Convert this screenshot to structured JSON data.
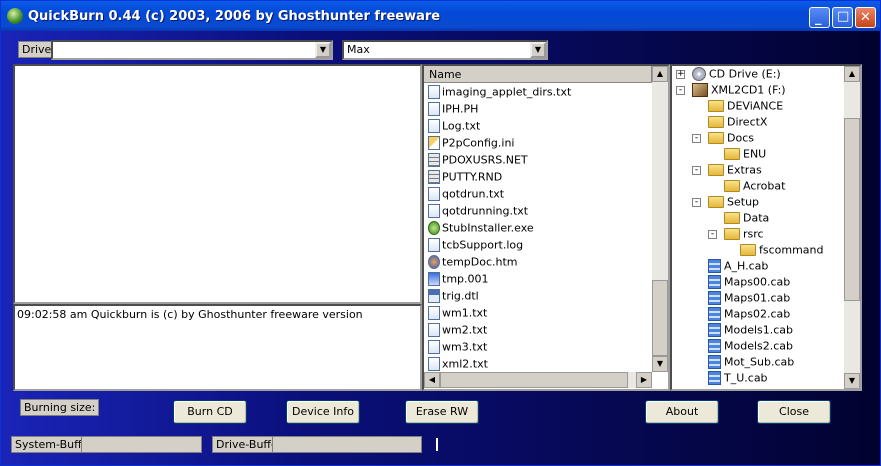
{
  "window": {
    "title": "QuickBurn 0.44 (c) 2003, 2006 by Ghosthunter freeware",
    "controls": {
      "minimize": "_",
      "maximize": "□",
      "close": "✕"
    }
  },
  "toolbar": {
    "drive_label": "Drive",
    "drive_value": "",
    "speed_value": "Max"
  },
  "log": {
    "message": "09:02:58 am Quickburn is (c) by Ghosthunter freeware version"
  },
  "file_list": {
    "column_header": "Name",
    "files": [
      {
        "name": "imaging_applet_dirs.txt",
        "icon": "txt"
      },
      {
        "name": "IPH.PH",
        "icon": "txt"
      },
      {
        "name": "Log.txt",
        "icon": "txt"
      },
      {
        "name": "P2pConfig.ini",
        "icon": "ini"
      },
      {
        "name": "PDOXUSRS.NET",
        "icon": "gear"
      },
      {
        "name": "PUTTY.RND",
        "icon": "gear"
      },
      {
        "name": "qotdrun.txt",
        "icon": "txt"
      },
      {
        "name": "qotdrunning.txt",
        "icon": "txt"
      },
      {
        "name": "StubInstaller.exe",
        "icon": "exe"
      },
      {
        "name": "tcbSupport.log",
        "icon": "txt"
      },
      {
        "name": "tempDoc.htm",
        "icon": "htm"
      },
      {
        "name": "tmp.001",
        "icon": "pc"
      },
      {
        "name": "trig.dtl",
        "icon": "dtl"
      },
      {
        "name": "wm1.txt",
        "icon": "txt"
      },
      {
        "name": "wm2.txt",
        "icon": "txt"
      },
      {
        "name": "wm3.txt",
        "icon": "txt"
      },
      {
        "name": "xml2.txt",
        "icon": "txt"
      }
    ]
  },
  "tree": {
    "nodes": [
      {
        "label": "CD Drive (E:)",
        "icon": "cd",
        "level": 0,
        "toggle": "+"
      },
      {
        "label": "XML2CD1 (F:)",
        "icon": "drive-image",
        "level": 0,
        "toggle": "-"
      },
      {
        "label": "DEViANCE",
        "icon": "folder",
        "level": 1,
        "toggle": ""
      },
      {
        "label": "DirectX",
        "icon": "folder",
        "level": 1,
        "toggle": ""
      },
      {
        "label": "Docs",
        "icon": "folder",
        "level": 1,
        "toggle": "-"
      },
      {
        "label": "ENU",
        "icon": "folder",
        "level": 2,
        "toggle": ""
      },
      {
        "label": "Extras",
        "icon": "folder",
        "level": 1,
        "toggle": "-"
      },
      {
        "label": "Acrobat",
        "icon": "folder",
        "level": 2,
        "toggle": ""
      },
      {
        "label": "Setup",
        "icon": "folder",
        "level": 1,
        "toggle": "-"
      },
      {
        "label": "Data",
        "icon": "folder",
        "level": 2,
        "toggle": ""
      },
      {
        "label": "rsrc",
        "icon": "folder",
        "level": 2,
        "toggle": "-"
      },
      {
        "label": "fscommand",
        "icon": "folder",
        "level": 3,
        "toggle": ""
      },
      {
        "label": "A_H.cab",
        "icon": "cab",
        "level": 1,
        "toggle": ""
      },
      {
        "label": "Maps00.cab",
        "icon": "cab",
        "level": 1,
        "toggle": ""
      },
      {
        "label": "Maps01.cab",
        "icon": "cab",
        "level": 1,
        "toggle": ""
      },
      {
        "label": "Maps02.cab",
        "icon": "cab",
        "level": 1,
        "toggle": ""
      },
      {
        "label": "Models1.cab",
        "icon": "cab",
        "level": 1,
        "toggle": ""
      },
      {
        "label": "Models2.cab",
        "icon": "cab",
        "level": 1,
        "toggle": ""
      },
      {
        "label": "Mot_Sub.cab",
        "icon": "cab",
        "level": 1,
        "toggle": ""
      },
      {
        "label": "T_U.cab",
        "icon": "cab",
        "level": 1,
        "toggle": ""
      }
    ]
  },
  "actions": {
    "burning_size_label": "Burning size:",
    "burn_cd": "Burn CD",
    "device_info": "Device Info",
    "erase_rw": "Erase RW",
    "about": "About",
    "close": "Close"
  },
  "buffers": {
    "system_label": "System-Buffer",
    "drive_label": "Drive-Buffer"
  },
  "scroll_arrows": {
    "up": "▲",
    "down": "▼",
    "left": "◀",
    "right": "▶",
    "dropdown": "▼"
  }
}
